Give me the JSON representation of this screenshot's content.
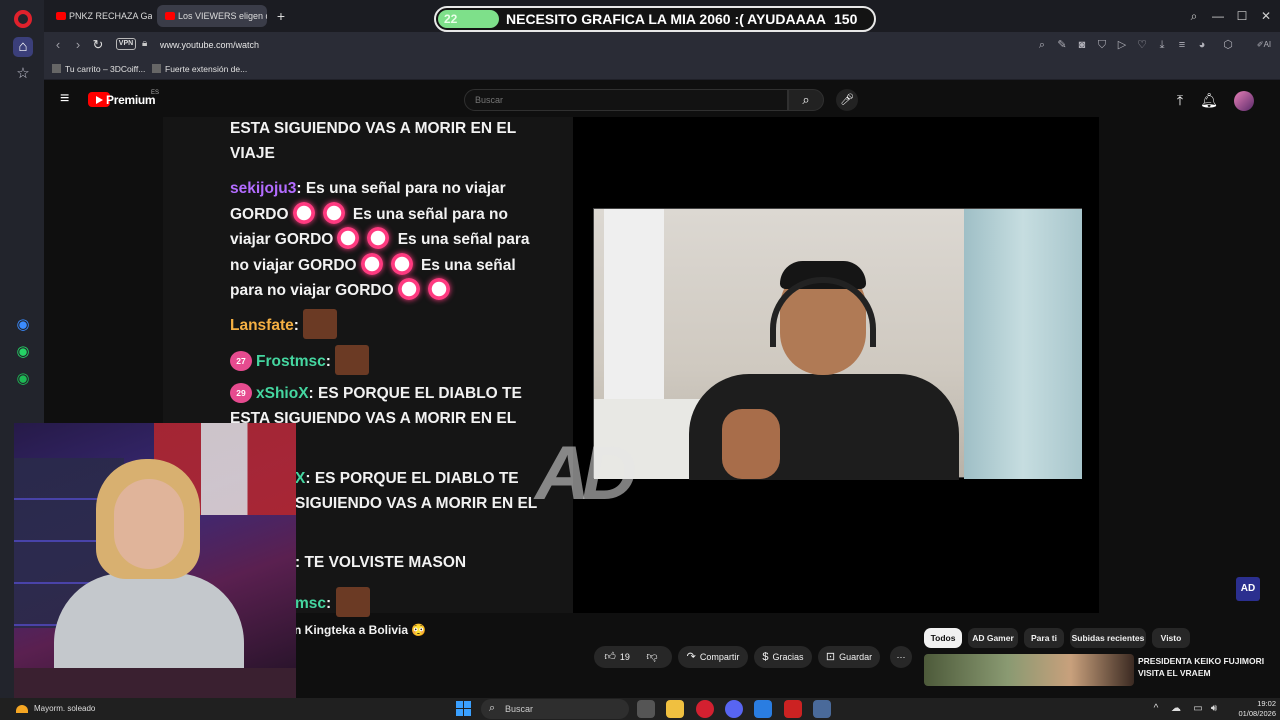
{
  "browser": {
    "tabs": [
      {
        "label": "PNKZ RECHAZA Ganar"
      },
      {
        "label": "Los VIEWERS eligen q"
      }
    ],
    "url": "www.youtube.com/watch",
    "vpn_label": "VPN",
    "bookmarks": [
      {
        "label": "Tu carrito – 3DCoiff..."
      },
      {
        "label": "Fuerte extensión de..."
      }
    ]
  },
  "stream_alert": {
    "count": "22",
    "progress_fraction": 0.14,
    "message": "NECESITO GRAFICA LA MIA 2060 :( AYUDAAAA",
    "goal": "150"
  },
  "youtube": {
    "premium_label": "Premium",
    "country_code": "ES",
    "search_placeholder": "Buscar",
    "video_title_fragment": "n Kingteka a Bolivia 😳",
    "actions": {
      "likes": "19",
      "share": "Compartir",
      "thanks": "Gracias",
      "save": "Guardar"
    },
    "chips": [
      "Todos",
      "AD Gamer",
      "Para ti",
      "Subidas recientes",
      "Visto"
    ],
    "recommendation_title": "PRESIDENTA KEIKO FUJIMORI VISITA EL VRAEM",
    "watermark": "AD",
    "channel_badge": "AD"
  },
  "chat": {
    "line1": "ESTA SIGUIENDO VAS A MORIR EN EL VIAJE",
    "msg2_user": "sekijoju3",
    "msg2_text_a": "Es una señal para no viajar GORDO",
    "msg2_text_b": "Es una señal para no viajar GORDO",
    "msg2_text_c": "Es una señal para no viajar GORDO",
    "msg2_text_d": "Es una señal para no viajar GORDO",
    "msg3_user": "Lansfate",
    "msg4_badge": "27",
    "msg4_user": "Frostmsc",
    "msg5_badge": "29",
    "msg5_user": "xShioX",
    "msg5_text": "ES PORQUE EL DIABLO TE ESTA SIGUIENDO VAS A MORIR EN EL",
    "msg6_user_fragment": "X",
    "msg6_text": "ES PORQUE EL DIABLO TE",
    "msg6_text2": "SIGUIENDO VAS A MORIR EN EL",
    "msg7_text": "TE VOLVISTE MASON",
    "msg8_user_fragment": "msc"
  },
  "taskbar": {
    "weather": "Mayorm. soleado",
    "search_label": "Buscar",
    "time": "19:02",
    "date": "01/08/2026"
  },
  "colors": {
    "accent_green": "#7ee08a",
    "chat_user_purple": "#b36cff",
    "chat_user_orange": "#f5b043",
    "chat_user_teal": "#45d6a0",
    "yt_red": "#ff0000"
  }
}
